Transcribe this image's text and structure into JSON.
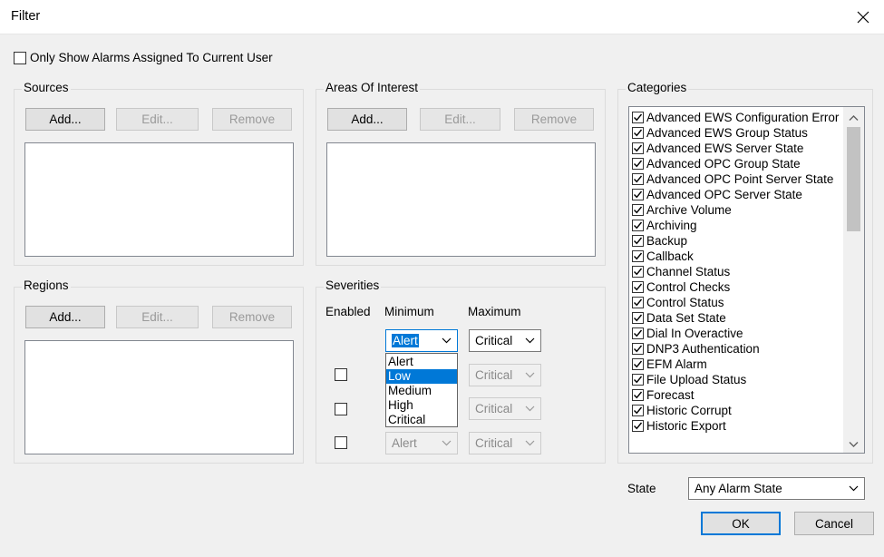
{
  "window": {
    "title": "Filter"
  },
  "only_show": {
    "label": "Only Show Alarms Assigned To Current User",
    "checked": false
  },
  "sources": {
    "title": "Sources",
    "add": "Add...",
    "edit": "Edit...",
    "remove": "Remove"
  },
  "areas": {
    "title": "Areas Of Interest",
    "add": "Add...",
    "edit": "Edit...",
    "remove": "Remove"
  },
  "regions": {
    "title": "Regions",
    "add": "Add...",
    "edit": "Edit...",
    "remove": "Remove"
  },
  "severities": {
    "title": "Severities",
    "enabled_header": "Enabled",
    "minimum_header": "Minimum",
    "maximum_header": "Maximum",
    "row1": {
      "min": "Alert",
      "max": "Critical"
    },
    "row2": {
      "min": "",
      "max": "Critical",
      "enabled": false
    },
    "row3": {
      "min": "",
      "max": "Critical",
      "enabled": false
    },
    "row4": {
      "min": "Alert",
      "max": "Critical",
      "enabled": false
    },
    "dropdown_options": [
      "Alert",
      "Low",
      "Medium",
      "High",
      "Critical"
    ],
    "dropdown_highlighted": "Low"
  },
  "categories": {
    "title": "Categories",
    "items": [
      "Advanced EWS Configuration Error",
      "Advanced EWS Group Status",
      "Advanced EWS Server State",
      "Advanced OPC Group State",
      "Advanced OPC Point Server State",
      "Advanced OPC Server State",
      "Archive Volume",
      "Archiving",
      "Backup",
      "Callback",
      "Channel Status",
      "Control Checks",
      "Control Status",
      "Data Set State",
      "Dial In Overactive",
      "DNP3 Authentication",
      "EFM Alarm",
      "File Upload Status",
      "Forecast",
      "Historic Corrupt",
      "Historic Export"
    ]
  },
  "state": {
    "label": "State",
    "value": "Any Alarm State"
  },
  "footer": {
    "ok": "OK",
    "cancel": "Cancel"
  },
  "colors": {
    "accent": "#0078d7",
    "highlight": "#0078d7"
  }
}
